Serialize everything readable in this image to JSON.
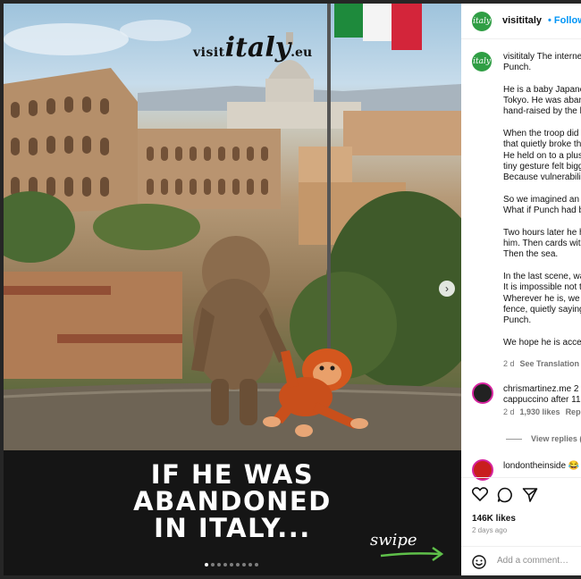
{
  "media": {
    "brand": {
      "prefix": "visit",
      "name": "italy",
      "suffix": ".eu"
    },
    "headline": [
      "IF HE WAS",
      "ABANDONED",
      "IN ITALY..."
    ],
    "swipe_label": "swipe",
    "carousel": {
      "count": 9,
      "active_index": 0
    },
    "next_icon": "chevron-right-icon"
  },
  "post": {
    "username": "visititaly",
    "separator": "•",
    "follow_label": "Follow",
    "avatar_text": "italy",
    "caption_lines": [
      "visititaly The interne",
      "Punch.",
      "",
      "He is a baby Japane",
      "Tokyo. He was aban",
      "hand-raised by the k",
      "",
      "When the troop did r",
      "that quietly broke th",
      " He held on to a plus",
      "tiny gesture felt bigg",
      " Because vulnerabili",
      "",
      "So we imagined an a",
      "What if Punch had b",
      "",
      "Two hours later he h",
      "him. Then cards with",
      "Then the sea.",
      "",
      "In the last scene, wa",
      "It is impossible not t",
      "Wherever he is, we",
      "fence, quietly saying",
      "Punch.",
      "",
      "We hope he is accep"
    ],
    "caption_time": "2 d",
    "see_translation": "See Translation"
  },
  "comments": [
    {
      "user": "chrismartinez.me",
      "text_line1": "2 w",
      "text_line2": "cappuccino after 11a",
      "time": "2 d",
      "likes": "1,930 likes",
      "reply": "Rep"
    },
    {
      "user": "londontheinside",
      "text_line1": "😂"
    }
  ],
  "view_replies": "View replies (6",
  "footer": {
    "likes": "146K likes",
    "ago": "2 days ago",
    "add_comment_placeholder": "Add a comment…"
  }
}
